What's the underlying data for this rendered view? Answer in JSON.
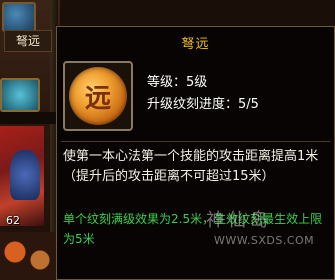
{
  "background": {
    "skill_label": "弩远",
    "item_count": "62"
  },
  "tooltip": {
    "title": "弩远",
    "icon_glyph": "远",
    "level_text": "等级：5级",
    "progress_text": "升级纹刻进度：5/5",
    "description": "使第一本心法第一个技能的攻击距离提高1米（提升后的攻击距离不可超过15米）",
    "bonus": "单个纹刻满级效果为2.5米，生效纹刻最生效上限为5米",
    "colors": {
      "title": "#f0c020",
      "description": "#f5f0e6",
      "bonus": "#3ad04a"
    }
  },
  "watermark": {
    "text": "神仙岛",
    "url": "WWW.SXDS.COM"
  }
}
